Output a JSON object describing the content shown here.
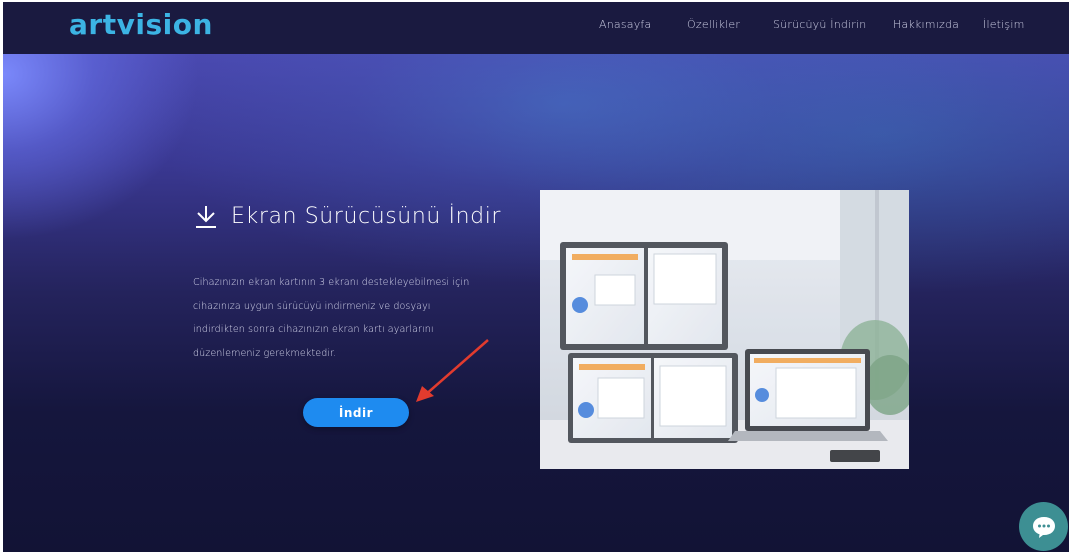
{
  "brand": {
    "logo_text": "artvision",
    "logo_color": "#3cb4e4"
  },
  "nav": {
    "items": [
      {
        "label": "Anasayfa"
      },
      {
        "label": "Özellikler"
      },
      {
        "label": "Sürücüyü İndirin"
      },
      {
        "label": "Hakkımızda"
      },
      {
        "label": "İletişim"
      }
    ]
  },
  "hero": {
    "icon": "download-icon",
    "title": "Ekran Sürücüsünü İndir",
    "description_lines": [
      "Cihazınızın ekran kartının 3 ekranı destekleyebilmesi için",
      "cihazınıza uygun sürücüyü indirmeniz ve dosyayı",
      "indirdikten sonra cihazınızın ekran kartı ayarlarını",
      "düzenlemeniz gerekmektedir."
    ],
    "download_button_label": "İndir",
    "button_color": "#1e8bf0",
    "annotation_arrow_color": "#e23b2e"
  },
  "chat": {
    "icon": "chat-bubble-icon",
    "color": "#3d8f93"
  }
}
